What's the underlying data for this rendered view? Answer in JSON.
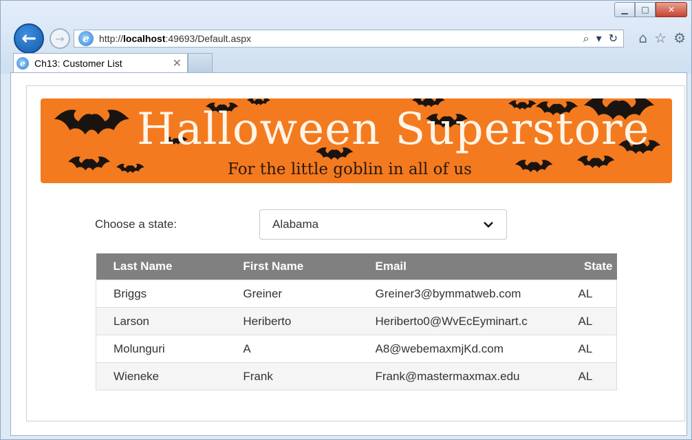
{
  "browser": {
    "url_prefix": "http://",
    "url_host": "localhost",
    "url_rest": ":49693/Default.aspx",
    "tab_title": "Ch13: Customer List"
  },
  "banner": {
    "title": "Halloween Superstore",
    "subtitle": "For the little goblin in all of us"
  },
  "form": {
    "state_label": "Choose a state:",
    "state_selected": "Alabama"
  },
  "table": {
    "headers": [
      "Last Name",
      "First Name",
      "Email",
      "State"
    ],
    "rows": [
      [
        "Briggs",
        "Greiner",
        "Greiner3@bymmatweb.com",
        "AL"
      ],
      [
        "Larson",
        "Heriberto",
        "Heriberto0@WvEcEyminart.c",
        "AL"
      ],
      [
        "Molunguri",
        "A",
        "A8@webemaxmjKd.com",
        "AL"
      ],
      [
        "Wieneke",
        "Frank",
        "Frank@mastermaxmax.edu",
        "AL"
      ]
    ]
  },
  "colors": {
    "banner": "#f47a1f",
    "table_header": "#808080",
    "back_button": "#1e6fc8"
  }
}
